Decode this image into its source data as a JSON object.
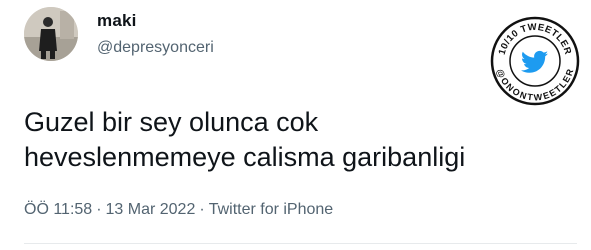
{
  "user": {
    "display_name": "maki",
    "handle": "@depresyonceri"
  },
  "badge": {
    "top_text": "10/10 TWEETLER",
    "bottom_text": "@ONONTWEETLER",
    "icon": "twitter-bird-icon"
  },
  "tweet": {
    "text": "Guzel bir sey olunca cok\nheveslenmemeye calisma garibanligi"
  },
  "meta": {
    "time": "ÖÖ 11:58",
    "separator": "·",
    "date": "13 Mar 2022",
    "source": "Twitter for iPhone"
  },
  "colors": {
    "text": "#0f1419",
    "secondary": "#536471",
    "twitter_blue": "#1d9bf0"
  }
}
